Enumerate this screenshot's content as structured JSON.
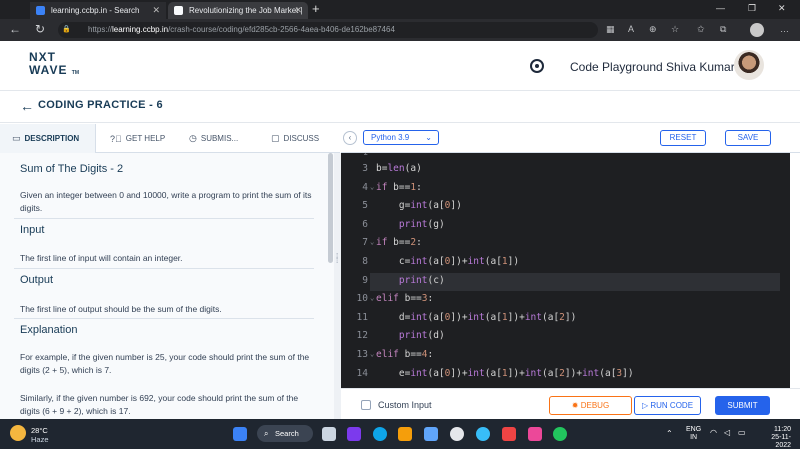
{
  "browser": {
    "tabs": [
      {
        "label": "learning.ccbp.in - Search"
      },
      {
        "label": "Revolutionizing the Job Market |"
      }
    ],
    "url_prefix": "https://",
    "url_domain": "learning.ccbp.in",
    "url_path": "/crash-course/coding/efd285cb-2566-4aea-b406-de162be87464"
  },
  "header": {
    "logo_line1": "NXT",
    "logo_line2": "WAVE",
    "logo_tm": "TM",
    "code_playground": "Code Playground",
    "user_name": "Shiva Kumar"
  },
  "practice": {
    "title": "CODING PRACTICE - 6"
  },
  "left_tabs": [
    {
      "label": "DESCRIPTION",
      "icon": "book-icon"
    },
    {
      "label": "GET HELP",
      "icon": "help-circle-icon"
    },
    {
      "label": "SUBMIS...",
      "icon": "clock-icon"
    },
    {
      "label": "DISCUSS",
      "icon": "chat-icon"
    }
  ],
  "description": {
    "problem_title": "Sum of The Digits - 2",
    "problem_text": "Given an integer between 0 and 10000, write a program to print the sum of its digits.",
    "input_heading": "Input",
    "input_text": "The first line of input will contain an integer.",
    "output_heading": "Output",
    "output_text": "The first line of output should be the sum of the digits.",
    "explanation_heading": "Explanation",
    "explanation_p1": "For example, if the given number is 25, your code should print the sum of the digits (2 + 5), which is 7.",
    "explanation_p2": "Similarly, if the given number is 692, your code should print the sum of the digits (6 + 9 + 2), which is 17."
  },
  "editor_toolbar": {
    "collapse": "‹",
    "language": "Python 3.9",
    "reset": "RESET",
    "save": "SAVE"
  },
  "code_lines": [
    {
      "num": "3",
      "text": "b=len(a)"
    },
    {
      "num": "4",
      "text": "if b==1:"
    },
    {
      "num": "5",
      "text": "    g=int(a[0])"
    },
    {
      "num": "6",
      "text": "    print(g)"
    },
    {
      "num": "7",
      "text": "if b==2:"
    },
    {
      "num": "8",
      "text": "    c=int(a[0])+int(a[1])"
    },
    {
      "num": "9",
      "text": "    print(c)"
    },
    {
      "num": "10",
      "text": "elif b==3:"
    },
    {
      "num": "11",
      "text": "    d=int(a[0])+int(a[1])+int(a[2])"
    },
    {
      "num": "12",
      "text": "    print(d)"
    },
    {
      "num": "13",
      "text": "elif b==4:"
    },
    {
      "num": "14",
      "text": "    e=int(a[0])+int(a[1])+int(a[2])+int(a[3])"
    }
  ],
  "bottom": {
    "custom_input": "Custom Input",
    "debug": "DEBUG",
    "run_code": "RUN CODE",
    "submit": "SUBMIT"
  },
  "taskbar": {
    "temperature": "28°C",
    "weather": "Haze",
    "search": "Search",
    "lang_top": "ENG",
    "lang_bottom": "IN",
    "time": "11:20",
    "date": "25-11-2022"
  },
  "colors": {
    "brand": "#183b56",
    "accent": "#2563eb",
    "debug": "#f97316",
    "editor_bg": "#1e1f22"
  }
}
